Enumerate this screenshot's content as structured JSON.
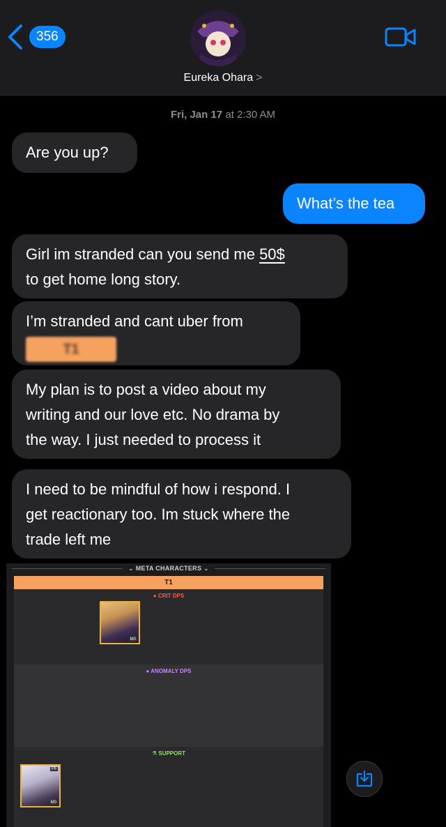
{
  "header": {
    "back_count": "356",
    "contact_name": "Eureka Ohara",
    "contact_chevron": ">",
    "icons": [
      "chevron-left-icon",
      "video-camera-icon"
    ]
  },
  "thread": {
    "timestamp_day": "Fri, Jan 17",
    "timestamp_at": "at",
    "timestamp_time": "2:30 AM",
    "messages": [
      {
        "direction": "incoming",
        "text": "Are you up?"
      },
      {
        "direction": "outgoing",
        "text": "What’s the tea"
      },
      {
        "direction": "incoming",
        "text_a": "Girl im stranded can you send me",
        "text_link": "50$",
        "text_b": "to get home long story."
      },
      {
        "direction": "incoming",
        "text": "I’m stranded and cant uber from",
        "redacted": "T1"
      },
      {
        "direction": "incoming",
        "line1": "My plan is to post a video about my",
        "line2": "writing and our love etc. No drama by",
        "line3": "the way. I just needed to process it"
      },
      {
        "direction": "incoming",
        "line1": "I need to be mindful of how i respond. I",
        "line2": "get reactionary too. Im stuck where the",
        "line3": "trade left me"
      }
    ]
  },
  "attachment": {
    "section_title": "META CHARACTERS",
    "tier": "T1",
    "categories": [
      {
        "label": "CRIT DPS",
        "color": "#ff5a4f"
      },
      {
        "label": "ANOMALY DPS",
        "color": "#c982ff"
      },
      {
        "label": "SUPPORT",
        "color": "#8ee06b"
      }
    ],
    "characters": [
      {
        "badge": "M0"
      },
      {
        "badge": "M0",
        "rank": "P6"
      }
    ]
  },
  "colors": {
    "incoming_bubble": "#262628",
    "outgoing_bubble": "#0a84ff",
    "tier_bar": "#f5a261"
  }
}
